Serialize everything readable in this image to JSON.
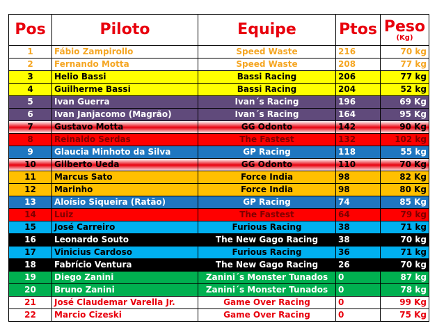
{
  "headers": {
    "pos": "Pos",
    "piloto": "Piloto",
    "equipe": "Equipe",
    "ptos": "Ptos",
    "peso": "Peso",
    "peso_unit": "(Kg)"
  },
  "colors": {
    "header_text": "#e8000d",
    "white": "#ffffff",
    "yellow": "#ffff00",
    "purple": "#604a7b",
    "red": "#ff0000",
    "blue": "#1f76c0",
    "orange": "#ffc000",
    "cyan": "#00b0f0",
    "black": "#000000",
    "green": "#00b050",
    "gold_text": "#f5a623",
    "maroon_text": "#7f0000",
    "red_text": "#e8000d"
  },
  "rows": [
    {
      "pos": "1",
      "piloto": "Fábio Zampirollo",
      "equipe": "Speed Waste",
      "ptos": "216",
      "peso": "70 kg",
      "bg": "white",
      "fg": "#f5a623"
    },
    {
      "pos": "2",
      "piloto": "Fernando Motta",
      "equipe": "Speed Waste",
      "ptos": "208",
      "peso": "77 kg",
      "bg": "white",
      "fg": "#f5a623"
    },
    {
      "pos": "3",
      "piloto": "Helio Bassi",
      "equipe": "Bassi Racing",
      "ptos": "206",
      "peso": "77 kg",
      "bg": "yellow",
      "fg": "#000000"
    },
    {
      "pos": "4",
      "piloto": "Guilherme Bassi",
      "equipe": "Bassi Racing",
      "ptos": "204",
      "peso": "52 kg",
      "bg": "yellow",
      "fg": "#000000"
    },
    {
      "pos": "5",
      "piloto": "Ivan Guerra",
      "equipe": "Ivan´s Racing",
      "ptos": "196",
      "peso": "69 Kg",
      "bg": "purple",
      "fg": "#ffffff"
    },
    {
      "pos": "6",
      "piloto": "Ivan Janjacomo (Magrão)",
      "equipe": "Ivan´s Racing",
      "ptos": "164",
      "peso": "95 Kg",
      "bg": "purple",
      "fg": "#ffffff"
    },
    {
      "pos": "7",
      "piloto": "Gustavo Motta",
      "equipe": "GG Odonto",
      "ptos": "142",
      "peso": "90 Kg",
      "bg": "redgrad",
      "fg": "#000000"
    },
    {
      "pos": "8",
      "piloto": "Reinaldo Serdas",
      "equipe": "The Fastest",
      "ptos": "132",
      "peso": "102 kg",
      "bg": "red",
      "fg": "#7f0000"
    },
    {
      "pos": "9",
      "piloto": "Glaucia Minhoto da Silva",
      "equipe": "GP Racing",
      "ptos": "118",
      "peso": "55 kg",
      "bg": "blue",
      "fg": "#ffffff"
    },
    {
      "pos": "10",
      "piloto": "Gilberto Ueda",
      "equipe": "GG Odonto",
      "ptos": "110",
      "peso": "70 Kg",
      "bg": "redgrad",
      "fg": "#000000"
    },
    {
      "pos": "11",
      "piloto": "Marcus Sato",
      "equipe": "Force India",
      "ptos": "98",
      "peso": "82 Kg",
      "bg": "orange",
      "fg": "#000000"
    },
    {
      "pos": "12",
      "piloto": "Marinho",
      "equipe": "Force India",
      "ptos": "98",
      "peso": "80 Kg",
      "bg": "orange",
      "fg": "#000000"
    },
    {
      "pos": "13",
      "piloto": "Aloísio Siqueira (Ratão)",
      "equipe": "GP Racing",
      "ptos": "74",
      "peso": "85 Kg",
      "bg": "blue",
      "fg": "#ffffff"
    },
    {
      "pos": "14",
      "piloto": "Luiz",
      "equipe": "The Fastest",
      "ptos": "64",
      "peso": "79 kg",
      "bg": "red",
      "fg": "#7f0000"
    },
    {
      "pos": "15",
      "piloto": "José Carreiro",
      "equipe": "Furious Racing",
      "ptos": "38",
      "peso": "71 kg",
      "bg": "cyan",
      "fg": "#000000"
    },
    {
      "pos": "16",
      "piloto": "Leonardo Souto",
      "equipe": "The New Gago Racing",
      "ptos": "38",
      "peso": "70 kg",
      "bg": "black",
      "fg": "#ffffff"
    },
    {
      "pos": "17",
      "piloto": "Vinicius Cardoso",
      "equipe": "Furious Racing",
      "ptos": "36",
      "peso": "71 kg",
      "bg": "cyan",
      "fg": "#000000"
    },
    {
      "pos": "18",
      "piloto": "Fabrício Ventura",
      "equipe": "The New Gago Racing",
      "ptos": "26",
      "peso": "70 kg",
      "bg": "black",
      "fg": "#ffffff"
    },
    {
      "pos": "19",
      "piloto": "Diego Zanini",
      "equipe": "Zanini´s Monster Tunados",
      "ptos": "0",
      "peso": "87 kg",
      "bg": "green",
      "fg": "#ffffff"
    },
    {
      "pos": "20",
      "piloto": "Bruno Zanini",
      "equipe": "Zanini´s Monster Tunados",
      "ptos": "0",
      "peso": "78 kg",
      "bg": "green",
      "fg": "#ffffff"
    },
    {
      "pos": "21",
      "piloto": "José Claudemar Varella Jr.",
      "equipe": "Game Over Racing",
      "ptos": "0",
      "peso": "99 Kg",
      "bg": "white",
      "fg": "#e8000d"
    },
    {
      "pos": "22",
      "piloto": "Marcio Cizeski",
      "equipe": "Game Over Racing",
      "ptos": "0",
      "peso": "75 Kg",
      "bg": "white",
      "fg": "#e8000d"
    }
  ]
}
